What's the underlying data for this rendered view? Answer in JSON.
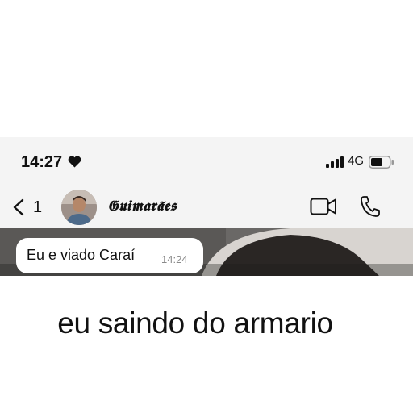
{
  "status_bar": {
    "time": "14:27",
    "network": "4G",
    "icons": [
      "heart-icon",
      "signal-bars-icon",
      "battery-icon"
    ]
  },
  "chat_header": {
    "back_count": "1",
    "contact_name": "𝕲𝖚𝖎𝖒𝖆𝖗𝖆̃𝖊𝖘",
    "icons": [
      "back-chevron-icon",
      "video-call-icon",
      "phone-icon"
    ]
  },
  "message": {
    "text": "Eu e viado Caraí",
    "time": "14:24"
  },
  "caption": "eu saindo do armario",
  "colors": {
    "header_bg": "#f4f4f4",
    "bubble_bg": "#ffffff",
    "timestamp": "#8a8a8a",
    "chat_bg": "#6d6a68"
  }
}
